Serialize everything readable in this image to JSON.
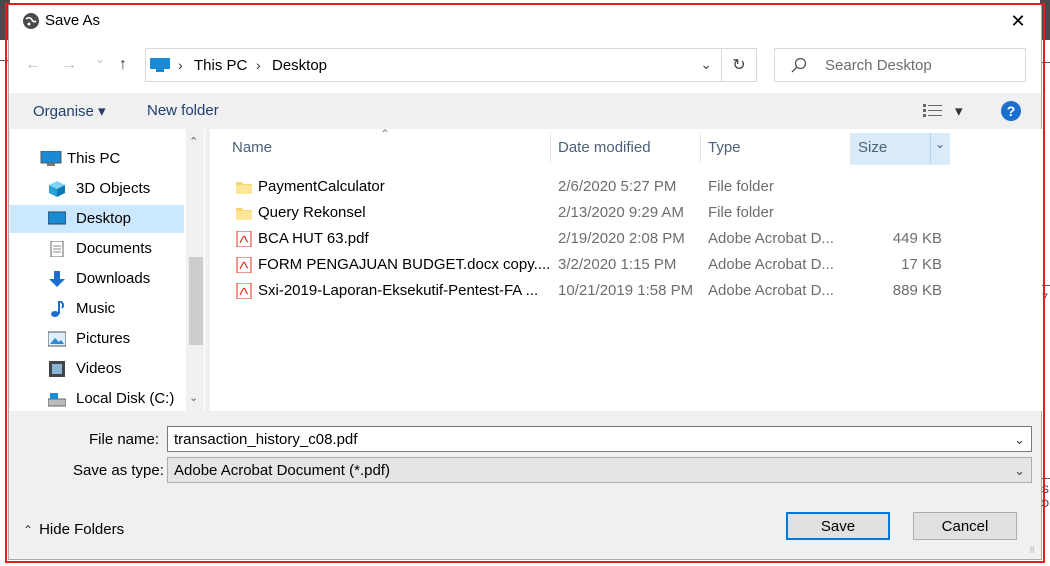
{
  "window": {
    "title": "Save As",
    "close_glyph": "✕"
  },
  "nav": {
    "back_glyph": "←",
    "forward_glyph": "→",
    "recent_glyph": "⌄",
    "up_glyph": "↑",
    "breadcrumb": [
      "This PC",
      "Desktop"
    ],
    "sep_glyph": "›",
    "dropdown_glyph": "⌄",
    "refresh_glyph": "↻",
    "search_placeholder": "Search Desktop"
  },
  "toolbar": {
    "organise": "Organise ▾",
    "new_folder": "New folder",
    "view_glyph": "▾",
    "help": "?"
  },
  "sidebar": {
    "items": [
      {
        "label": "This PC",
        "icon": "pc-icon"
      },
      {
        "label": "3D Objects",
        "icon": "cube-icon"
      },
      {
        "label": "Desktop",
        "icon": "desktop-icon",
        "selected": true
      },
      {
        "label": "Documents",
        "icon": "documents-icon"
      },
      {
        "label": "Downloads",
        "icon": "downloads-icon"
      },
      {
        "label": "Music",
        "icon": "music-icon"
      },
      {
        "label": "Pictures",
        "icon": "pictures-icon"
      },
      {
        "label": "Videos",
        "icon": "videos-icon"
      },
      {
        "label": "Local Disk (C:)",
        "icon": "disk-icon"
      }
    ],
    "scroll_up_glyph": "⌃",
    "scroll_down_glyph": "⌄"
  },
  "files": {
    "columns": {
      "name": "Name",
      "date": "Date modified",
      "type": "Type",
      "size": "Size"
    },
    "sort_glyph": "⌃",
    "size_dropdown_glyph": "⌄",
    "rows": [
      {
        "name": "PaymentCalculator",
        "date": "2/6/2020 5:27 PM",
        "type": "File folder",
        "size": "",
        "icon": "folder-icon"
      },
      {
        "name": "Query Rekonsel",
        "date": "2/13/2020 9:29 AM",
        "type": "File folder",
        "size": "",
        "icon": "folder-icon"
      },
      {
        "name": "BCA HUT 63.pdf",
        "date": "2/19/2020 2:08 PM",
        "type": "Adobe Acrobat D...",
        "size": "449 KB",
        "icon": "pdf-icon"
      },
      {
        "name": "FORM PENGAJUAN BUDGET.docx copy....",
        "date": "3/2/2020 1:15 PM",
        "type": "Adobe Acrobat D...",
        "size": "17 KB",
        "icon": "pdf-icon"
      },
      {
        "name": "Sxi-2019-Laporan-Eksekutif-Pentest-FA ...",
        "date": "10/21/2019 1:58 PM",
        "type": "Adobe Acrobat D...",
        "size": "889 KB",
        "icon": "pdf-icon"
      }
    ]
  },
  "form": {
    "file_name_label": "File name:",
    "file_name_value": "transaction_history_c08.pdf",
    "save_type_label": "Save as type:",
    "save_type_value": "Adobe Acrobat Document (*.pdf)",
    "dropdown_glyph": "⌄"
  },
  "footer": {
    "hide_folders": "Hide Folders",
    "hide_glyph": "⌃",
    "save": "Save",
    "cancel": "Cancel",
    "grip": "⠿"
  },
  "background": {
    "right_glyph_1": "7",
    "right_glyph_2": "S",
    "right_glyph_3": "O"
  }
}
